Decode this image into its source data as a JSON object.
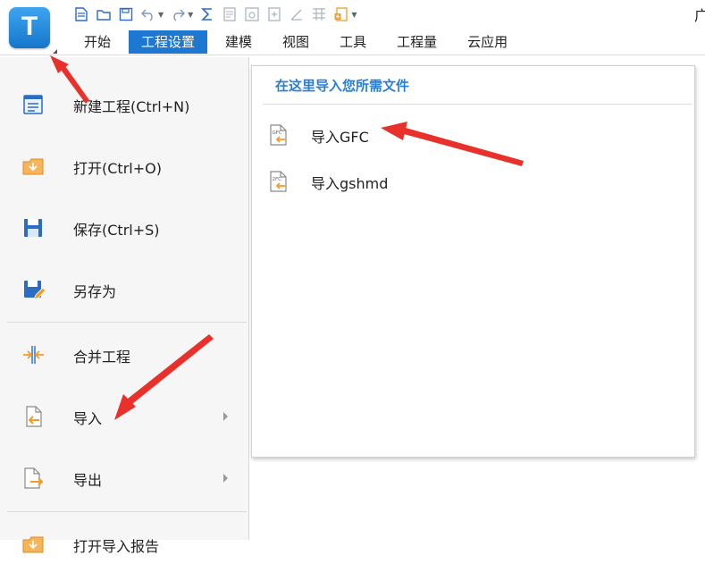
{
  "app": {
    "logo_letter": "T",
    "title_fragment": "广"
  },
  "quick_access": {
    "icons": [
      "new-file-icon",
      "open-folder-icon",
      "save-icon",
      "undo-icon",
      "redo-icon",
      "sum-icon",
      "report-icon",
      "view-icon",
      "calc-icon",
      "pen-icon",
      "grid-icon",
      "template-icon",
      "dropdown-icon"
    ]
  },
  "tabs": [
    {
      "label": "开始",
      "active": false
    },
    {
      "label": "工程设置",
      "active": true
    },
    {
      "label": "建模",
      "active": false
    },
    {
      "label": "视图",
      "active": false
    },
    {
      "label": "工具",
      "active": false
    },
    {
      "label": "工程量",
      "active": false
    },
    {
      "label": "云应用",
      "active": false
    }
  ],
  "file_menu": {
    "items": [
      {
        "label": "新建工程(Ctrl+N)",
        "icon": "new-project-icon"
      },
      {
        "label": "打开(Ctrl+O)",
        "icon": "open-icon"
      },
      {
        "label": "保存(Ctrl+S)",
        "icon": "save-icon"
      },
      {
        "label": "另存为",
        "icon": "save-as-icon"
      },
      {
        "label": "合并工程",
        "icon": "merge-icon"
      },
      {
        "label": "导入",
        "icon": "import-icon",
        "has_submenu": true
      },
      {
        "label": "导出",
        "icon": "export-icon",
        "has_submenu": true
      },
      {
        "label": "打开导入报告",
        "icon": "report-folder-icon"
      }
    ]
  },
  "import_submenu": {
    "title": "在这里导入您所需文件",
    "items": [
      {
        "label": "导入GFC",
        "icon": "gfc-file-icon",
        "icon_text": "GFC"
      },
      {
        "label": "导入gshmd",
        "icon": "gshmd-file-icon",
        "icon_text": "2FC"
      }
    ]
  },
  "colors": {
    "accent": "#1e78d2",
    "submenu_title": "#2a7fd4",
    "annotation_arrow": "#e8312a",
    "icon_orange": "#f39c2a",
    "icon_blue": "#2b6cc4"
  }
}
